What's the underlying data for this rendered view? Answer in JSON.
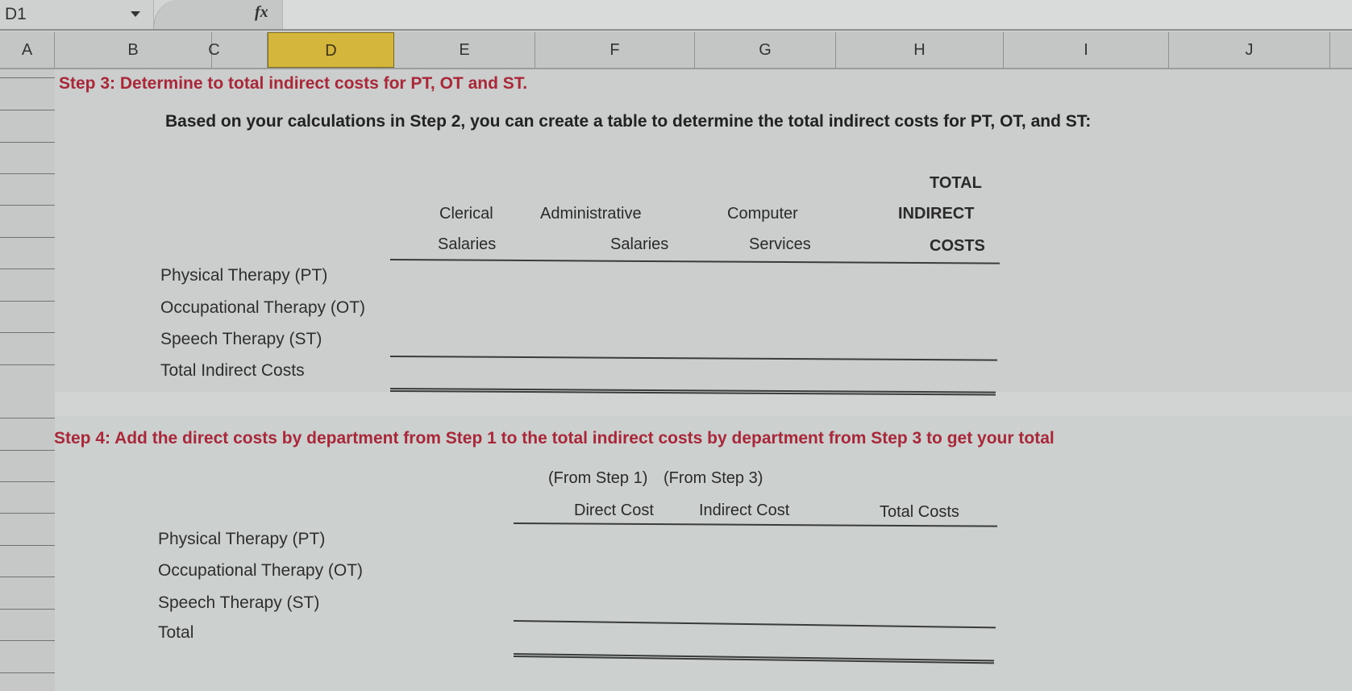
{
  "formula_bar": {
    "name_box": "D1",
    "fx_label": "fx",
    "formula_value": ""
  },
  "columns": [
    "A",
    "B",
    "C",
    "D",
    "E",
    "F",
    "G",
    "H",
    "I",
    "J"
  ],
  "selected_column": "D",
  "colors": {
    "step_title": "#a8283a",
    "selected_column": "#d4b63c"
  },
  "step3": {
    "title": "Step 3:  Determine to total indirect costs for PT, OT and ST.",
    "intro": "Based on your calculations in Step 2, you can create a table to determine the total indirect costs for PT, OT, and ST:",
    "headers": {
      "clerical": [
        "Clerical",
        "Salaries"
      ],
      "administrative": [
        "Administrative",
        "Salaries"
      ],
      "computer": [
        "Computer",
        "Services"
      ],
      "total": [
        "TOTAL",
        "INDIRECT",
        "COSTS"
      ]
    },
    "rows": [
      {
        "label": "Physical Therapy (PT)"
      },
      {
        "label": "Occupational Therapy (OT)"
      },
      {
        "label": "Speech Therapy (ST)"
      },
      {
        "label": "Total Indirect Costs"
      }
    ]
  },
  "step4": {
    "title": "Step 4:  Add the direct costs by department from Step 1 to the total indirect costs by department from Step 3 to get your total",
    "subheaders": {
      "from_step1": "(From Step 1)",
      "from_step3": "(From Step 3)"
    },
    "headers": {
      "direct": "Direct Cost",
      "indirect": "Indirect Cost",
      "total": "Total Costs"
    },
    "rows": [
      {
        "label": "Physical Therapy (PT)"
      },
      {
        "label": "Occupational Therapy (OT)"
      },
      {
        "label": "Speech Therapy (ST)"
      },
      {
        "label": "Total"
      }
    ]
  }
}
